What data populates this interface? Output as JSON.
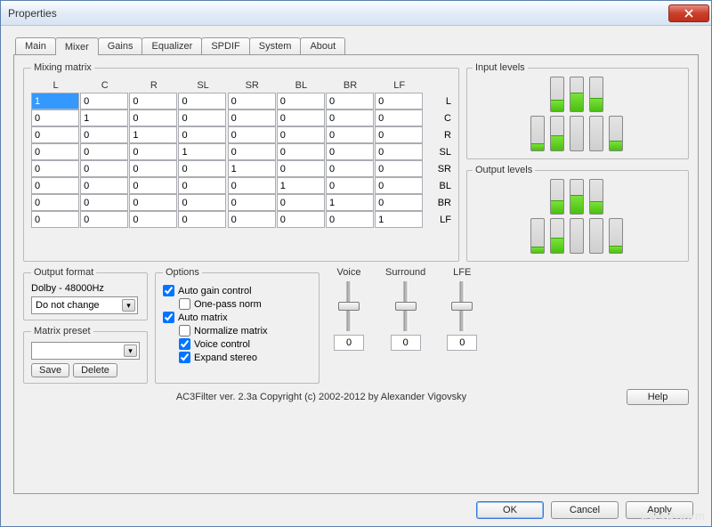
{
  "title": "Properties",
  "tabs": [
    "Main",
    "Mixer",
    "Gains",
    "Equalizer",
    "SPDIF",
    "System",
    "About"
  ],
  "active_tab": 1,
  "mixing_matrix": {
    "label": "Mixing matrix",
    "cols": [
      "L",
      "C",
      "R",
      "SL",
      "SR",
      "BL",
      "BR",
      "LF"
    ],
    "rows": [
      "L",
      "C",
      "R",
      "SL",
      "SR",
      "BL",
      "BR",
      "LF"
    ],
    "selected_cell": [
      0,
      0
    ],
    "values": [
      [
        "1",
        "0",
        "0",
        "0",
        "0",
        "0",
        "0",
        "0"
      ],
      [
        "0",
        "1",
        "0",
        "0",
        "0",
        "0",
        "0",
        "0"
      ],
      [
        "0",
        "0",
        "1",
        "0",
        "0",
        "0",
        "0",
        "0"
      ],
      [
        "0",
        "0",
        "0",
        "1",
        "0",
        "0",
        "0",
        "0"
      ],
      [
        "0",
        "0",
        "0",
        "0",
        "1",
        "0",
        "0",
        "0"
      ],
      [
        "0",
        "0",
        "0",
        "0",
        "0",
        "1",
        "0",
        "0"
      ],
      [
        "0",
        "0",
        "0",
        "0",
        "0",
        "0",
        "1",
        "0"
      ],
      [
        "0",
        "0",
        "0",
        "0",
        "0",
        "0",
        "0",
        "1"
      ]
    ]
  },
  "output_format": {
    "label": "Output format",
    "status": "Dolby - 48000Hz",
    "combo": "Do not change"
  },
  "matrix_preset": {
    "label": "Matrix preset",
    "value": "",
    "save": "Save",
    "delete": "Delete"
  },
  "options": {
    "label": "Options",
    "auto_gain": {
      "label": "Auto gain control",
      "checked": true
    },
    "one_pass": {
      "label": "One-pass norm",
      "checked": false
    },
    "auto_matrix": {
      "label": "Auto matrix",
      "checked": true
    },
    "normalize": {
      "label": "Normalize matrix",
      "checked": false
    },
    "voice_ctrl": {
      "label": "Voice control",
      "checked": true
    },
    "expand_stereo": {
      "label": "Expand stereo",
      "checked": true
    }
  },
  "sliders": {
    "voice": {
      "label": "Voice",
      "value": "0"
    },
    "surround": {
      "label": "Surround",
      "value": "0"
    },
    "lfe": {
      "label": "LFE",
      "value": "0"
    }
  },
  "input_levels": {
    "label": "Input levels",
    "positions": [
      null,
      35,
      55,
      40,
      null,
      20,
      45,
      null,
      null,
      28
    ],
    "slots": [
      false,
      true,
      true,
      true,
      false,
      true,
      true,
      true,
      true,
      true
    ]
  },
  "output_levels": {
    "label": "Output levels",
    "positions": [
      null,
      40,
      55,
      38,
      null,
      18,
      45,
      null,
      null,
      22
    ],
    "slots": [
      false,
      true,
      true,
      true,
      false,
      true,
      true,
      true,
      true,
      true
    ]
  },
  "copyright": "AC3Filter ver. 2.3a Copyright (c) 2002-2012 by Alexander Vigovsky",
  "buttons": {
    "help": "Help",
    "ok": "OK",
    "cancel": "Cancel",
    "apply": "Apply"
  },
  "watermark": "LO4D.com"
}
